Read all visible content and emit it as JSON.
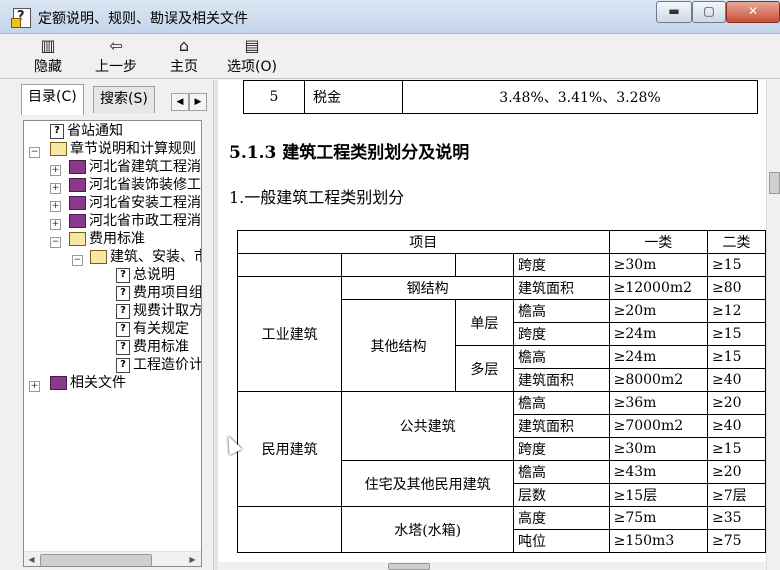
{
  "window": {
    "title": "定额说明、规则、勘误及相关文件",
    "min_label": "▬",
    "max_label": "▢",
    "close_label": "✕"
  },
  "toolbar": {
    "hide": {
      "label": "隐藏",
      "icon": "hide-pane-icon"
    },
    "back": {
      "label": "上一步",
      "icon": "back-arrow-icon"
    },
    "home": {
      "label": "主页",
      "icon": "home-icon"
    },
    "options": {
      "label": "选项(O)",
      "icon": "options-icon"
    }
  },
  "tabs": {
    "contents": "目录(C)",
    "search": "搜索(S)"
  },
  "tree": [
    {
      "label": "省站通知"
    },
    {
      "label": "章节说明和计算规则"
    },
    {
      "label": "河北省建筑工程消耗量定额"
    },
    {
      "label": "河北省装饰装修工程消耗量定额"
    },
    {
      "label": "河北省安装工程消耗量定额"
    },
    {
      "label": "河北省市政工程消耗量定额"
    },
    {
      "label": "费用标准"
    },
    {
      "label": "建筑、安装、市政工程"
    },
    {
      "label": "总说明"
    },
    {
      "label": "费用项目组成"
    },
    {
      "label": "规费计取方法"
    },
    {
      "label": "有关规定"
    },
    {
      "label": "费用标准"
    },
    {
      "label": "工程造价计算程序"
    },
    {
      "label": "相关文件"
    }
  ],
  "content": {
    "tax_row": {
      "no": "5",
      "name": "税金",
      "value": "3.48%、3.41%、3.28%"
    },
    "heading": "5.1.3  建筑工程类别划分及说明",
    "subheading": "1.一般建筑工程类别划分",
    "table": {
      "h_item": "项目",
      "h_c1": "一类",
      "h_c2": "二类",
      "industrial": "工业建筑",
      "steel": "钢结构",
      "other_struct": "其他结构",
      "single": "单层",
      "multi": "多层",
      "civil": "民用建筑",
      "public": "公共建筑",
      "residential": "住宅及其他民用建筑",
      "water_tower": "水塔(水箱)",
      "span": "跨度",
      "area": "建筑面积",
      "eave": "檐高",
      "floors": "层数",
      "height": "高度",
      "tonnage": "吨位",
      "r0": [
        "≥30m",
        "≥15"
      ],
      "r1": [
        "≥12000m2",
        "≥80"
      ],
      "r2": [
        "≥20m",
        "≥12"
      ],
      "r3": [
        "≥24m",
        "≥15"
      ],
      "r4": [
        "≥24m",
        "≥15"
      ],
      "r5": [
        "≥8000m2",
        "≥40"
      ],
      "r6": [
        "≥36m",
        "≥20"
      ],
      "r7": [
        "≥7000m2",
        "≥40"
      ],
      "r8": [
        "≥30m",
        "≥15"
      ],
      "r9": [
        "≥43m",
        "≥20"
      ],
      "r10": [
        "≥15层",
        "≥7层"
      ],
      "r11": [
        "≥75m",
        "≥35"
      ],
      "r12": [
        "≥150m3",
        "≥75"
      ]
    }
  }
}
